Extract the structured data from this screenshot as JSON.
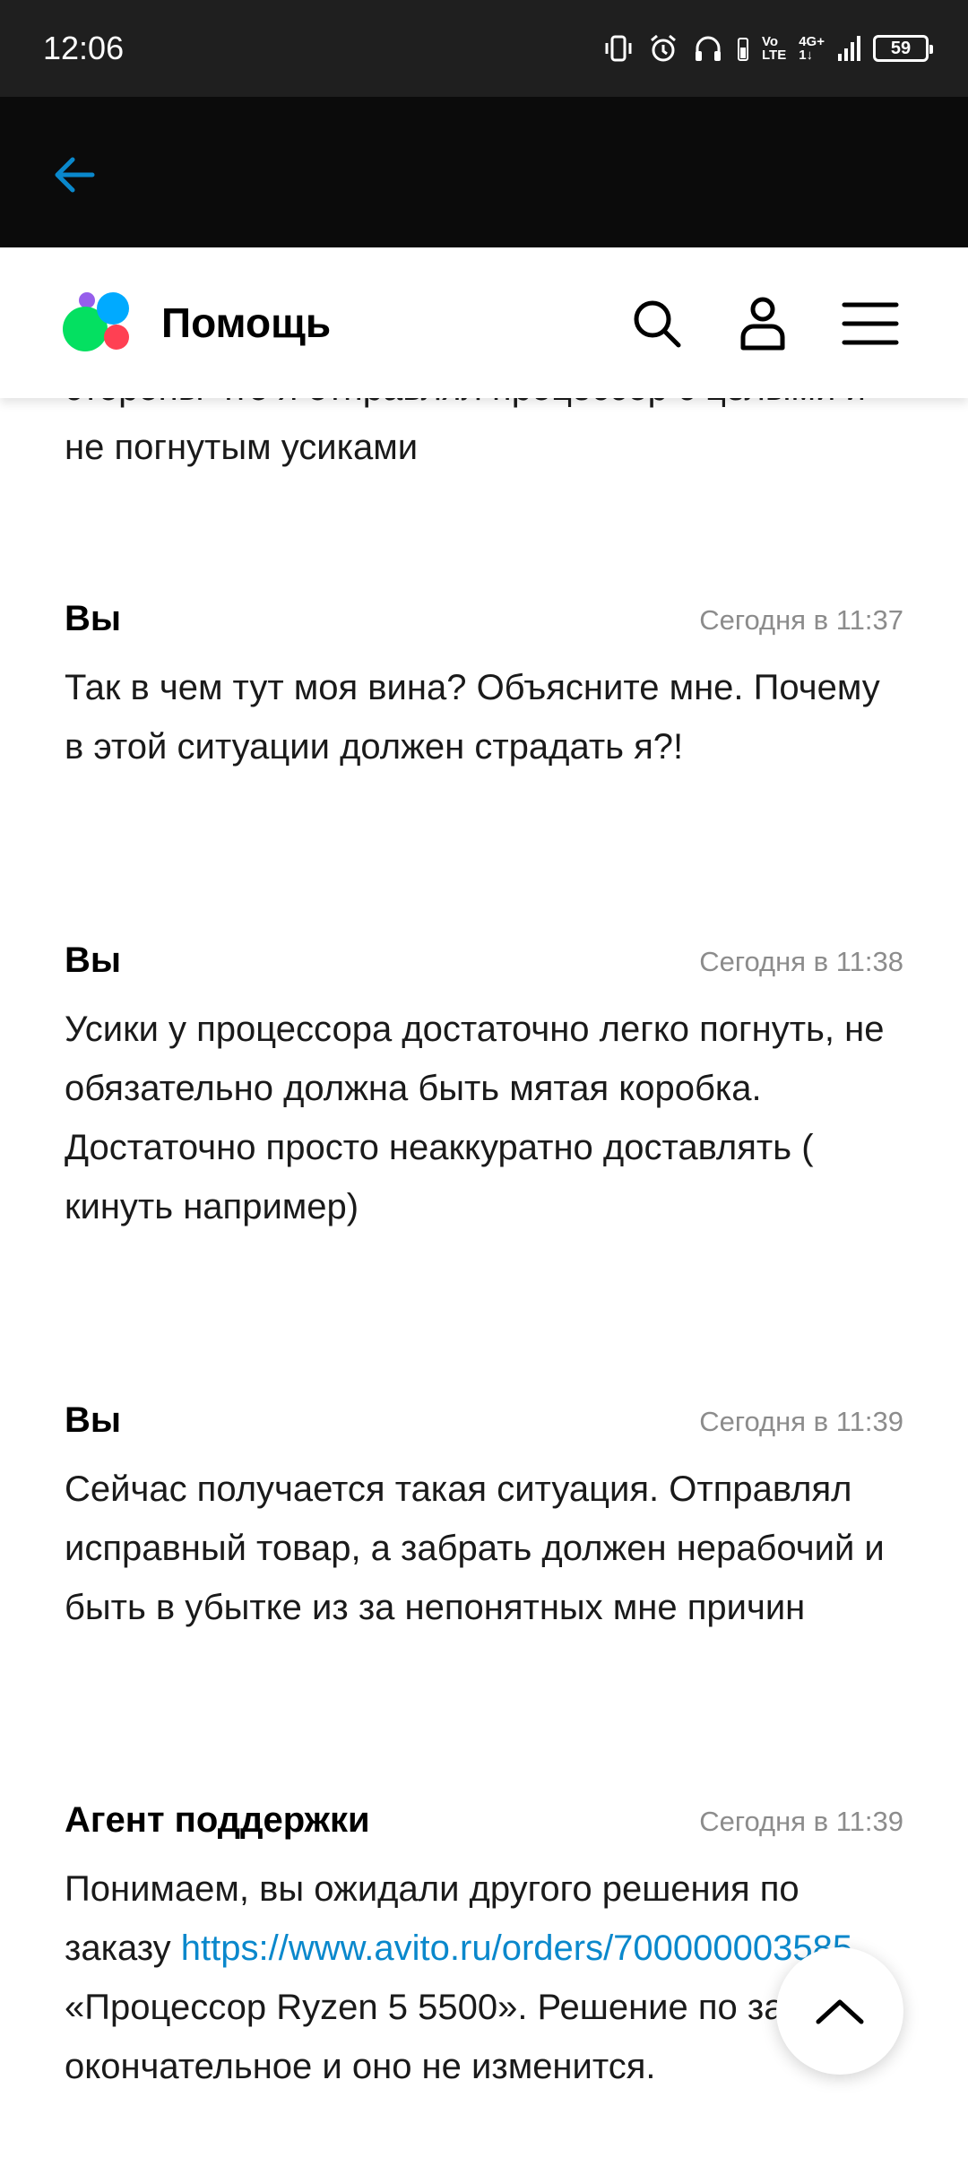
{
  "status_bar": {
    "time": "12:06",
    "volte_top": "Vo",
    "volte_bottom": "LTE",
    "network_top": "4G+",
    "network_bottom": "1↓",
    "battery": "59"
  },
  "app_bar": {
    "back_icon": "arrow-left-icon",
    "accent_color": "#0a88cc"
  },
  "header": {
    "title": "Помощь",
    "logo_colors": [
      "#965eeb",
      "#04e061",
      "#0af",
      "#ff4053"
    ],
    "icons": [
      "search-icon",
      "user-icon",
      "menu-icon"
    ]
  },
  "chat": {
    "previous_text": "стороны что я отправлял процессор с целыми и не погнутым усиками",
    "messages": [
      {
        "author": "Вы",
        "time": "Сегодня в 11:37",
        "text": "Так в чем тут моя вина? Объясните мне. Почему в этой ситуации должен страдать я?!"
      },
      {
        "author": "Вы",
        "time": "Сегодня в 11:38",
        "text": "Усики у процессора достаточно легко погнуть, не обязательно должна быть мятая коробка. Достаточно просто неаккуратно доставлять ( кинуть например)"
      },
      {
        "author": "Вы",
        "time": "Сегодня в 11:39",
        "text": "Сейчас получается такая ситуация. Отправлял исправный товар, а забрать должен нерабочий и быть в убытке из за непонятных мне причин"
      },
      {
        "author": "Агент поддержки",
        "time": "Сегодня в 11:39",
        "text_before": "Понимаем, вы ожидали другого решения по заказу",
        "link": "https://www.avito.ru/orders/700000003585",
        "text_after": "«Процессор Ryzen 5 5500». Решение по заявке окончательное и оно не изменится."
      }
    ]
  },
  "scroll_top": {
    "icon": "chevron-up-icon"
  }
}
